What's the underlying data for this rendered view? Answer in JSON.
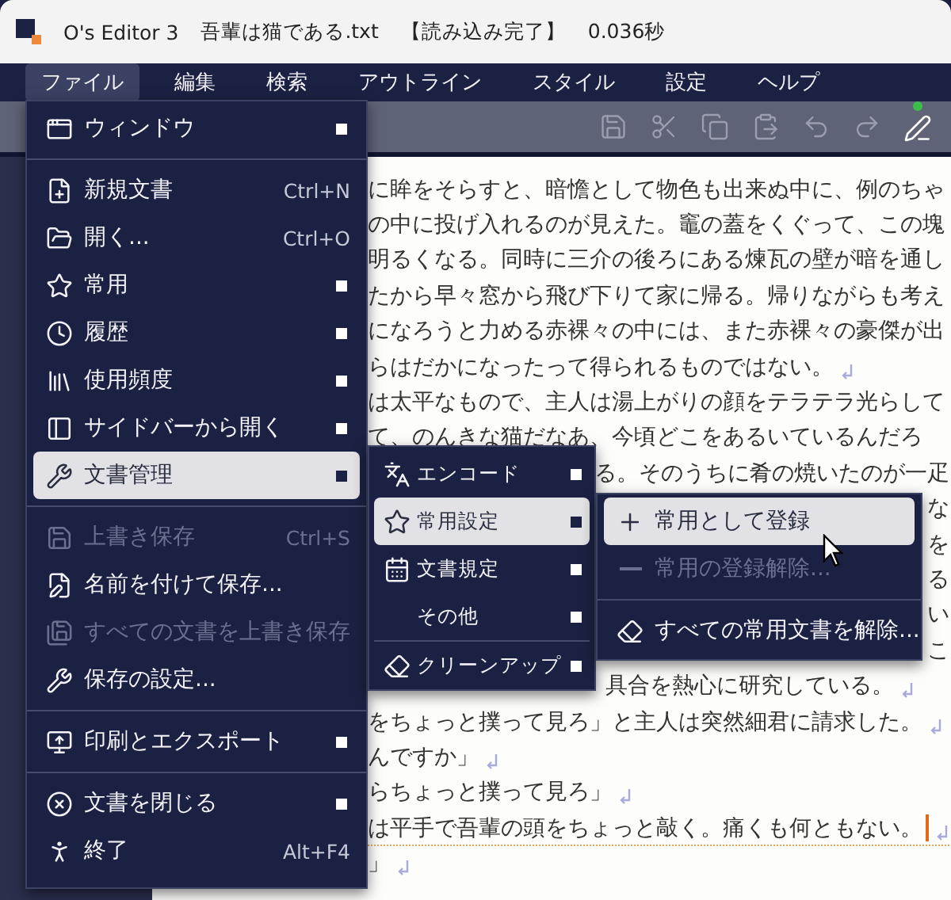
{
  "title_bar": {
    "app": "O's Editor 3",
    "file": "吾輩は猫である.txt",
    "status": "【読み込み完了】",
    "time": "0.036秒"
  },
  "menu_bar": [
    {
      "label": "ファイル",
      "selected": true
    },
    {
      "label": "編集",
      "selected": false
    },
    {
      "label": "検索",
      "selected": false
    },
    {
      "label": "アウトライン",
      "selected": false
    },
    {
      "label": "スタイル",
      "selected": false
    },
    {
      "label": "設定",
      "selected": false
    },
    {
      "label": "ヘルプ",
      "selected": false
    }
  ],
  "editor": {
    "lines": [
      {
        "kind": "full",
        "text": "に眸をそらすと、暗憺として物色も出来ぬ中に、例のちゃ",
        "eol_mark": false,
        "cursor": false
      },
      {
        "kind": "full",
        "text": "の中に投げ入れるのが見えた。竈の蓋をくぐって、この塊",
        "eol_mark": false,
        "cursor": false
      },
      {
        "kind": "full",
        "text": "明るくなる。同時に三介の後ろにある煉瓦の壁が暗を通し",
        "eol_mark": false,
        "cursor": false
      },
      {
        "kind": "full",
        "text": "たから早々窓から飛び下りて家に帰る。帰りながらも考え",
        "eol_mark": false,
        "cursor": false
      },
      {
        "kind": "full",
        "text": "になろうと力める赤裸々の中には、また赤裸々の豪傑が出",
        "eol_mark": false,
        "cursor": false
      },
      {
        "kind": "full",
        "text": "らはだかになったって得られるものではない。",
        "eol_mark": true,
        "cursor": false
      },
      {
        "kind": "full",
        "text": "は太平なもので、主人は湯上がりの顔をテラテラ光らして",
        "eol_mark": false,
        "cursor": false
      },
      {
        "kind": "full",
        "text": "て、のんきな猫だなあ、今頃どこをあるいているんだろ",
        "eol_mark": false,
        "cursor": false
      },
      {
        "kind": "tail",
        "text": "る。そのうちに肴の焼いたのが一疋",
        "eol_mark": false,
        "cursor": false
      },
      {
        "kind": "tail",
        "text": "な",
        "eol_mark": false,
        "cursor": false
      },
      {
        "kind": "tail",
        "text": "を",
        "eol_mark": false,
        "cursor": false
      },
      {
        "kind": "tail",
        "text": "る",
        "eol_mark": false,
        "cursor": false
      },
      {
        "kind": "tail",
        "text": "い",
        "eol_mark": false,
        "cursor": false
      },
      {
        "kind": "tail",
        "text": "こ",
        "eol_mark": false,
        "cursor": false
      },
      {
        "kind": "offset",
        "text": "具合を熱心に研究している。",
        "eol_mark": true,
        "cursor": false
      },
      {
        "kind": "full",
        "text": "をちょっと撲って見ろ」と主人は突然細君に請求した。",
        "eol_mark": true,
        "cursor": false
      },
      {
        "kind": "full",
        "text": "んですか」",
        "eol_mark": true,
        "cursor": false
      },
      {
        "kind": "full",
        "text": "らちょっと撲って見ろ」",
        "eol_mark": true,
        "cursor": false
      },
      {
        "kind": "full",
        "text": "は平手で吾輩の頭をちょっと敲く。痛くも何ともない。",
        "eol_mark": true,
        "cursor": true
      },
      {
        "kind": "full",
        "text": "」",
        "eol_mark": true,
        "cursor": false
      }
    ]
  },
  "file_menu": [
    {
      "kind": "item",
      "label": "ウィンドウ",
      "submenu": true,
      "selected": false,
      "disabled": false
    },
    {
      "kind": "separator"
    },
    {
      "kind": "item",
      "label": "新規文書",
      "shortcut": "Ctrl+N",
      "submenu": false,
      "selected": false,
      "disabled": false
    },
    {
      "kind": "item",
      "label": "開く...",
      "shortcut": "Ctrl+O",
      "submenu": false,
      "selected": false,
      "disabled": false
    },
    {
      "kind": "item",
      "label": "常用",
      "submenu": true,
      "selected": false,
      "disabled": false
    },
    {
      "kind": "item",
      "label": "履歴",
      "submenu": true,
      "selected": false,
      "disabled": false
    },
    {
      "kind": "item",
      "label": "使用頻度",
      "submenu": true,
      "selected": false,
      "disabled": false
    },
    {
      "kind": "item",
      "label": "サイドバーから開く",
      "submenu": true,
      "selected": false,
      "disabled": false
    },
    {
      "kind": "item",
      "label": "文書管理",
      "submenu": true,
      "selected": true,
      "disabled": false
    },
    {
      "kind": "separator"
    },
    {
      "kind": "item",
      "label": "上書き保存",
      "shortcut": "Ctrl+S",
      "submenu": false,
      "selected": false,
      "disabled": true
    },
    {
      "kind": "item",
      "label": "名前を付けて保存...",
      "submenu": false,
      "selected": false,
      "disabled": false
    },
    {
      "kind": "item",
      "label": "すべての文書を上書き保存",
      "submenu": false,
      "selected": false,
      "disabled": true
    },
    {
      "kind": "item",
      "label": "保存の設定...",
      "submenu": false,
      "selected": false,
      "disabled": false
    },
    {
      "kind": "separator"
    },
    {
      "kind": "item",
      "label": "印刷とエクスポート",
      "submenu": true,
      "selected": false,
      "disabled": false
    },
    {
      "kind": "separator"
    },
    {
      "kind": "item",
      "label": "文書を閉じる",
      "submenu": true,
      "selected": false,
      "disabled": false
    },
    {
      "kind": "item",
      "label": "終了",
      "shortcut": "Alt+F4",
      "submenu": false,
      "selected": false,
      "disabled": false
    }
  ],
  "document_menu": [
    {
      "kind": "item",
      "label": "エンコード",
      "submenu": true,
      "selected": false,
      "disabled": false
    },
    {
      "kind": "item",
      "label": "常用設定",
      "submenu": true,
      "selected": true,
      "disabled": false
    },
    {
      "kind": "item",
      "label": "文書規定",
      "submenu": true,
      "selected": false,
      "disabled": false
    },
    {
      "kind": "item",
      "label": "その他",
      "submenu": true,
      "selected": false,
      "disabled": false
    },
    {
      "kind": "separator"
    },
    {
      "kind": "item",
      "label": "クリーンアップ",
      "submenu": true,
      "selected": false,
      "disabled": false
    }
  ],
  "favorites_menu": [
    {
      "kind": "item",
      "label": "常用として登録",
      "submenu": false,
      "selected": true,
      "disabled": false
    },
    {
      "kind": "item",
      "label": "常用の登録解除...",
      "submenu": false,
      "selected": false,
      "disabled": true
    },
    {
      "kind": "separator"
    },
    {
      "kind": "item",
      "label": "すべての常用文書を解除...",
      "submenu": false,
      "selected": false,
      "disabled": false
    }
  ]
}
